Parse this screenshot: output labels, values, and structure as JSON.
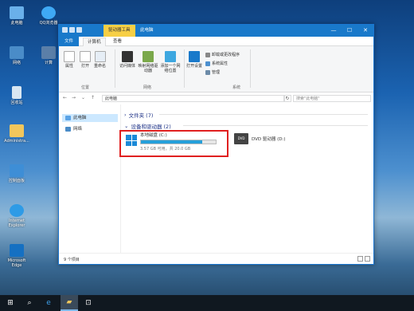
{
  "desktop": {
    "icons": [
      {
        "label": "此电脑",
        "icon": "computer-icon"
      },
      {
        "label": "QQ浏览器",
        "icon": "qq-browser-icon"
      },
      {
        "label": "网络",
        "icon": "network-icon"
      },
      {
        "label": "回收站",
        "icon": "recycle-bin-icon"
      },
      {
        "label": "Administra...",
        "icon": "user-folder-icon"
      },
      {
        "label": "控制面板",
        "icon": "control-panel-icon"
      },
      {
        "label": "Internet Explorer",
        "icon": "ie-icon"
      },
      {
        "label": "Microsoft Edge",
        "icon": "edge-icon"
      },
      {
        "label": "计算",
        "icon": "app-icon"
      }
    ]
  },
  "window": {
    "title": "此电脑",
    "context_tab": "驱动器工具",
    "controls": {
      "minimize": "—",
      "maximize": "☐",
      "close": "✕"
    }
  },
  "tabs": {
    "file": "文件",
    "computer": "计算机",
    "view": "查看"
  },
  "ribbon": {
    "properties": "属性",
    "open": "打开",
    "rename": "重命名",
    "location_group": "位置",
    "access_media": "访问媒体",
    "map_drive": "映射网络驱动器",
    "add_location": "添加一个网络位置",
    "network_group": "网络",
    "open_settings": "打开设置",
    "uninstall": "卸载或更改程序",
    "system_props": "系统属性",
    "manage": "管理",
    "system_group": "系统"
  },
  "address": {
    "path": "此电脑",
    "search_placeholder": "搜索\"此电脑\""
  },
  "nav": {
    "this_pc": "此电脑",
    "network": "网络"
  },
  "content": {
    "folders_header": "文件夹 (7)",
    "devices_header": "设备和驱动器 (2)",
    "drive_c": {
      "name": "本地磁盘 (C:)",
      "space": "3.57 GB 可用，共 20.0 GB",
      "used_fraction": 0.82
    },
    "drive_dvd": {
      "name": "DVD 驱动器 (D:)",
      "icon_text": "DVD"
    }
  },
  "status": {
    "count": "9 个项目"
  }
}
